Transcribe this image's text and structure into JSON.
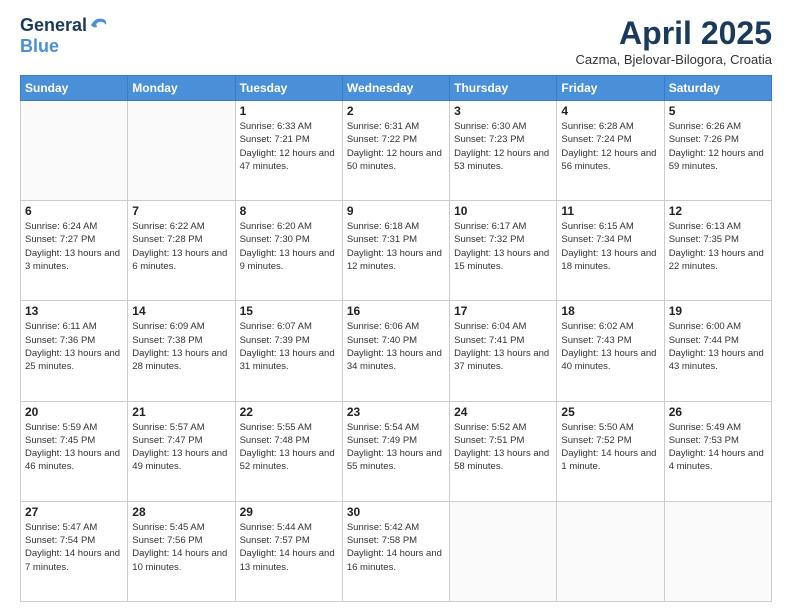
{
  "logo": {
    "line1": "General",
    "line2": "Blue"
  },
  "title": "April 2025",
  "location": "Cazma, Bjelovar-Bilogora, Croatia",
  "headers": [
    "Sunday",
    "Monday",
    "Tuesday",
    "Wednesday",
    "Thursday",
    "Friday",
    "Saturday"
  ],
  "days": [
    {
      "day": "",
      "sunrise": "",
      "sunset": "",
      "daylight": "",
      "empty": true
    },
    {
      "day": "",
      "sunrise": "",
      "sunset": "",
      "daylight": "",
      "empty": true
    },
    {
      "day": "1",
      "sunrise": "Sunrise: 6:33 AM",
      "sunset": "Sunset: 7:21 PM",
      "daylight": "Daylight: 12 hours and 47 minutes."
    },
    {
      "day": "2",
      "sunrise": "Sunrise: 6:31 AM",
      "sunset": "Sunset: 7:22 PM",
      "daylight": "Daylight: 12 hours and 50 minutes."
    },
    {
      "day": "3",
      "sunrise": "Sunrise: 6:30 AM",
      "sunset": "Sunset: 7:23 PM",
      "daylight": "Daylight: 12 hours and 53 minutes."
    },
    {
      "day": "4",
      "sunrise": "Sunrise: 6:28 AM",
      "sunset": "Sunset: 7:24 PM",
      "daylight": "Daylight: 12 hours and 56 minutes."
    },
    {
      "day": "5",
      "sunrise": "Sunrise: 6:26 AM",
      "sunset": "Sunset: 7:26 PM",
      "daylight": "Daylight: 12 hours and 59 minutes."
    },
    {
      "day": "6",
      "sunrise": "Sunrise: 6:24 AM",
      "sunset": "Sunset: 7:27 PM",
      "daylight": "Daylight: 13 hours and 3 minutes."
    },
    {
      "day": "7",
      "sunrise": "Sunrise: 6:22 AM",
      "sunset": "Sunset: 7:28 PM",
      "daylight": "Daylight: 13 hours and 6 minutes."
    },
    {
      "day": "8",
      "sunrise": "Sunrise: 6:20 AM",
      "sunset": "Sunset: 7:30 PM",
      "daylight": "Daylight: 13 hours and 9 minutes."
    },
    {
      "day": "9",
      "sunrise": "Sunrise: 6:18 AM",
      "sunset": "Sunset: 7:31 PM",
      "daylight": "Daylight: 13 hours and 12 minutes."
    },
    {
      "day": "10",
      "sunrise": "Sunrise: 6:17 AM",
      "sunset": "Sunset: 7:32 PM",
      "daylight": "Daylight: 13 hours and 15 minutes."
    },
    {
      "day": "11",
      "sunrise": "Sunrise: 6:15 AM",
      "sunset": "Sunset: 7:34 PM",
      "daylight": "Daylight: 13 hours and 18 minutes."
    },
    {
      "day": "12",
      "sunrise": "Sunrise: 6:13 AM",
      "sunset": "Sunset: 7:35 PM",
      "daylight": "Daylight: 13 hours and 22 minutes."
    },
    {
      "day": "13",
      "sunrise": "Sunrise: 6:11 AM",
      "sunset": "Sunset: 7:36 PM",
      "daylight": "Daylight: 13 hours and 25 minutes."
    },
    {
      "day": "14",
      "sunrise": "Sunrise: 6:09 AM",
      "sunset": "Sunset: 7:38 PM",
      "daylight": "Daylight: 13 hours and 28 minutes."
    },
    {
      "day": "15",
      "sunrise": "Sunrise: 6:07 AM",
      "sunset": "Sunset: 7:39 PM",
      "daylight": "Daylight: 13 hours and 31 minutes."
    },
    {
      "day": "16",
      "sunrise": "Sunrise: 6:06 AM",
      "sunset": "Sunset: 7:40 PM",
      "daylight": "Daylight: 13 hours and 34 minutes."
    },
    {
      "day": "17",
      "sunrise": "Sunrise: 6:04 AM",
      "sunset": "Sunset: 7:41 PM",
      "daylight": "Daylight: 13 hours and 37 minutes."
    },
    {
      "day": "18",
      "sunrise": "Sunrise: 6:02 AM",
      "sunset": "Sunset: 7:43 PM",
      "daylight": "Daylight: 13 hours and 40 minutes."
    },
    {
      "day": "19",
      "sunrise": "Sunrise: 6:00 AM",
      "sunset": "Sunset: 7:44 PM",
      "daylight": "Daylight: 13 hours and 43 minutes."
    },
    {
      "day": "20",
      "sunrise": "Sunrise: 5:59 AM",
      "sunset": "Sunset: 7:45 PM",
      "daylight": "Daylight: 13 hours and 46 minutes."
    },
    {
      "day": "21",
      "sunrise": "Sunrise: 5:57 AM",
      "sunset": "Sunset: 7:47 PM",
      "daylight": "Daylight: 13 hours and 49 minutes."
    },
    {
      "day": "22",
      "sunrise": "Sunrise: 5:55 AM",
      "sunset": "Sunset: 7:48 PM",
      "daylight": "Daylight: 13 hours and 52 minutes."
    },
    {
      "day": "23",
      "sunrise": "Sunrise: 5:54 AM",
      "sunset": "Sunset: 7:49 PM",
      "daylight": "Daylight: 13 hours and 55 minutes."
    },
    {
      "day": "24",
      "sunrise": "Sunrise: 5:52 AM",
      "sunset": "Sunset: 7:51 PM",
      "daylight": "Daylight: 13 hours and 58 minutes."
    },
    {
      "day": "25",
      "sunrise": "Sunrise: 5:50 AM",
      "sunset": "Sunset: 7:52 PM",
      "daylight": "Daylight: 14 hours and 1 minute."
    },
    {
      "day": "26",
      "sunrise": "Sunrise: 5:49 AM",
      "sunset": "Sunset: 7:53 PM",
      "daylight": "Daylight: 14 hours and 4 minutes."
    },
    {
      "day": "27",
      "sunrise": "Sunrise: 5:47 AM",
      "sunset": "Sunset: 7:54 PM",
      "daylight": "Daylight: 14 hours and 7 minutes."
    },
    {
      "day": "28",
      "sunrise": "Sunrise: 5:45 AM",
      "sunset": "Sunset: 7:56 PM",
      "daylight": "Daylight: 14 hours and 10 minutes."
    },
    {
      "day": "29",
      "sunrise": "Sunrise: 5:44 AM",
      "sunset": "Sunset: 7:57 PM",
      "daylight": "Daylight: 14 hours and 13 minutes."
    },
    {
      "day": "30",
      "sunrise": "Sunrise: 5:42 AM",
      "sunset": "Sunset: 7:58 PM",
      "daylight": "Daylight: 14 hours and 16 minutes."
    },
    {
      "day": "",
      "sunrise": "",
      "sunset": "",
      "daylight": "",
      "empty": true
    },
    {
      "day": "",
      "sunrise": "",
      "sunset": "",
      "daylight": "",
      "empty": true
    },
    {
      "day": "",
      "sunrise": "",
      "sunset": "",
      "daylight": "",
      "empty": true
    }
  ]
}
